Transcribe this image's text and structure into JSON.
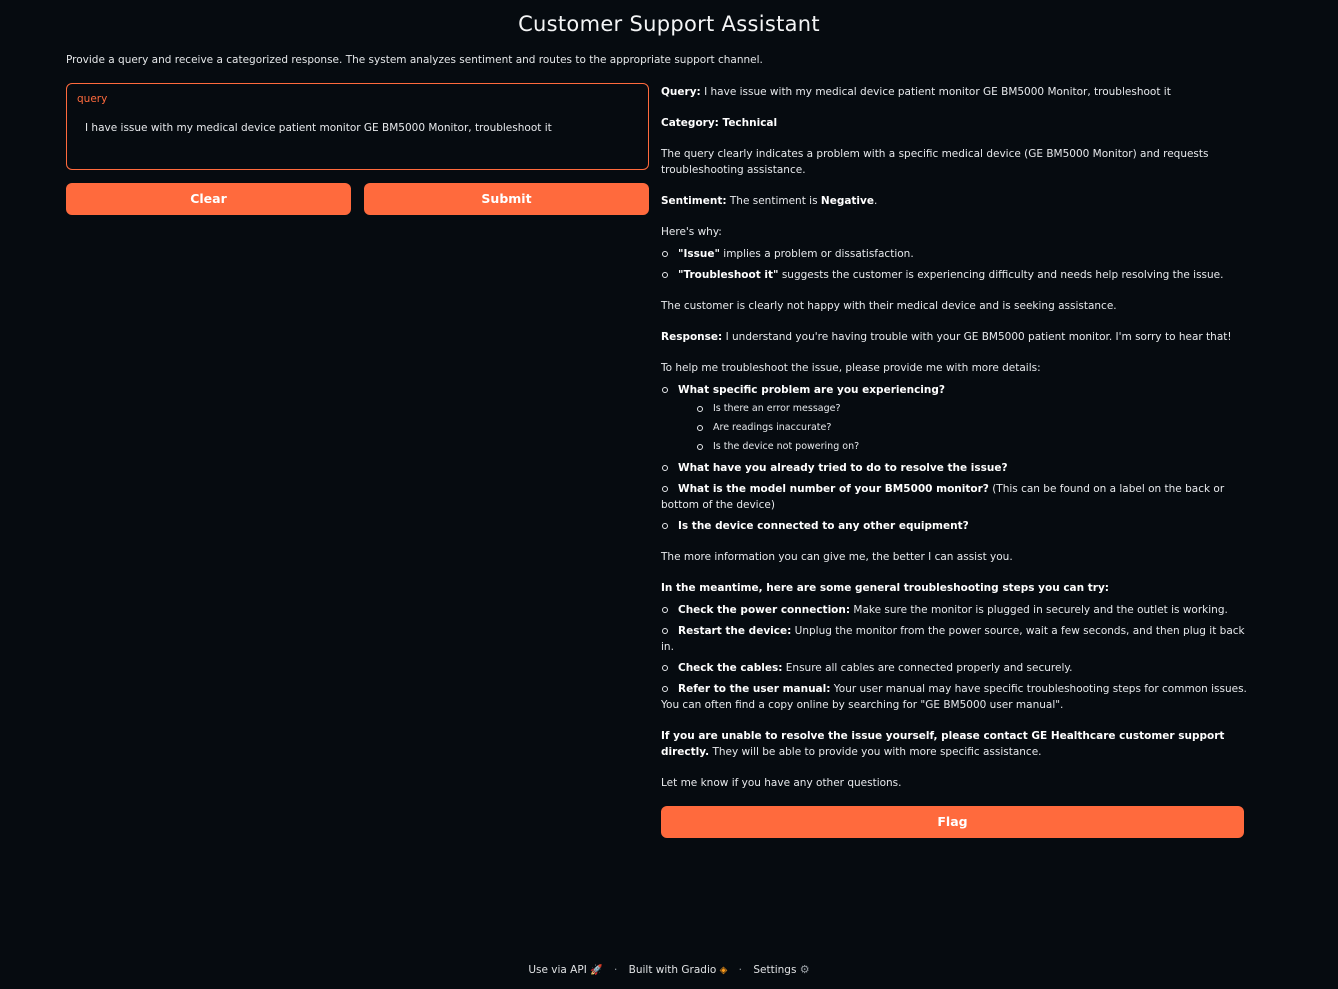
{
  "app": {
    "title": "Customer Support Assistant",
    "description": "Provide a query and receive a categorized response. The system analyzes sentiment and routes to the appropriate support channel."
  },
  "input": {
    "label": "query",
    "value": "I have issue with my medical device patient monitor GE BM5000 Monitor, troubleshoot it"
  },
  "buttons": {
    "clear": "Clear",
    "submit": "Submit",
    "flag": "Flag"
  },
  "output": {
    "query_label": "Query:",
    "query_text": " I have issue with my medical device patient monitor GE BM5000 Monitor, troubleshoot it",
    "category_label": "Category:",
    "category_value": " Technical",
    "category_explain": "The query clearly indicates a problem with a specific medical device (GE BM5000 Monitor) and requests troubleshooting assistance.",
    "sentiment_label": "Sentiment:",
    "sentiment_pre": " The sentiment is ",
    "sentiment_value": "Negative",
    "sentiment_post": ".",
    "why_intro": "Here's why:",
    "why_1_bold": "\"Issue\"",
    "why_1_text": " implies a problem or dissatisfaction.",
    "why_2_bold": "\"Troubleshoot it\"",
    "why_2_text": " suggests the customer is experiencing difficulty and needs help resolving the issue.",
    "why_conclusion": "The customer is clearly not happy with their medical device and is seeking assistance.",
    "response_label": "Response:",
    "response_text": " I understand you're having trouble with your GE BM5000 patient monitor. I'm sorry to hear that!",
    "details_intro": "To help me troubleshoot the issue, please provide me with more details:",
    "q1": "What specific problem are you experiencing?",
    "q1_sub": [
      "Is there an error message?",
      "Are readings inaccurate?",
      "Is the device not powering on?"
    ],
    "q2": "What have you already tried to do to resolve the issue?",
    "q3_bold": "What is the model number of your BM5000 monitor?",
    "q3_text": " (This can be found on a label on the back or bottom of the device)",
    "q4": "Is the device connected to any other equipment?",
    "more_info": "The more information you can give me, the better I can assist you.",
    "meantime": "In the meantime, here are some general troubleshooting steps you can try:",
    "s1_bold": "Check the power connection:",
    "s1_text": " Make sure the monitor is plugged in securely and the outlet is working.",
    "s2_bold": "Restart the device:",
    "s2_text": " Unplug the monitor from the power source, wait a few seconds, and then plug it back in.",
    "s3_bold": "Check the cables:",
    "s3_text": " Ensure all cables are connected properly and securely.",
    "s4_bold": "Refer to the user manual:",
    "s4_text": " Your user manual may have specific troubleshooting steps for common issues. You can often find a copy online by searching for \"GE BM5000 user manual\".",
    "contact_bold": "If you are unable to resolve the issue yourself, please contact GE Healthcare customer support directly.",
    "contact_text": " They will be able to provide you with more specific assistance.",
    "closing": "Let me know if you have any other questions."
  },
  "footer": {
    "api": "Use via API",
    "built": "Built with Gradio",
    "settings": "Settings",
    "separator": "·"
  }
}
